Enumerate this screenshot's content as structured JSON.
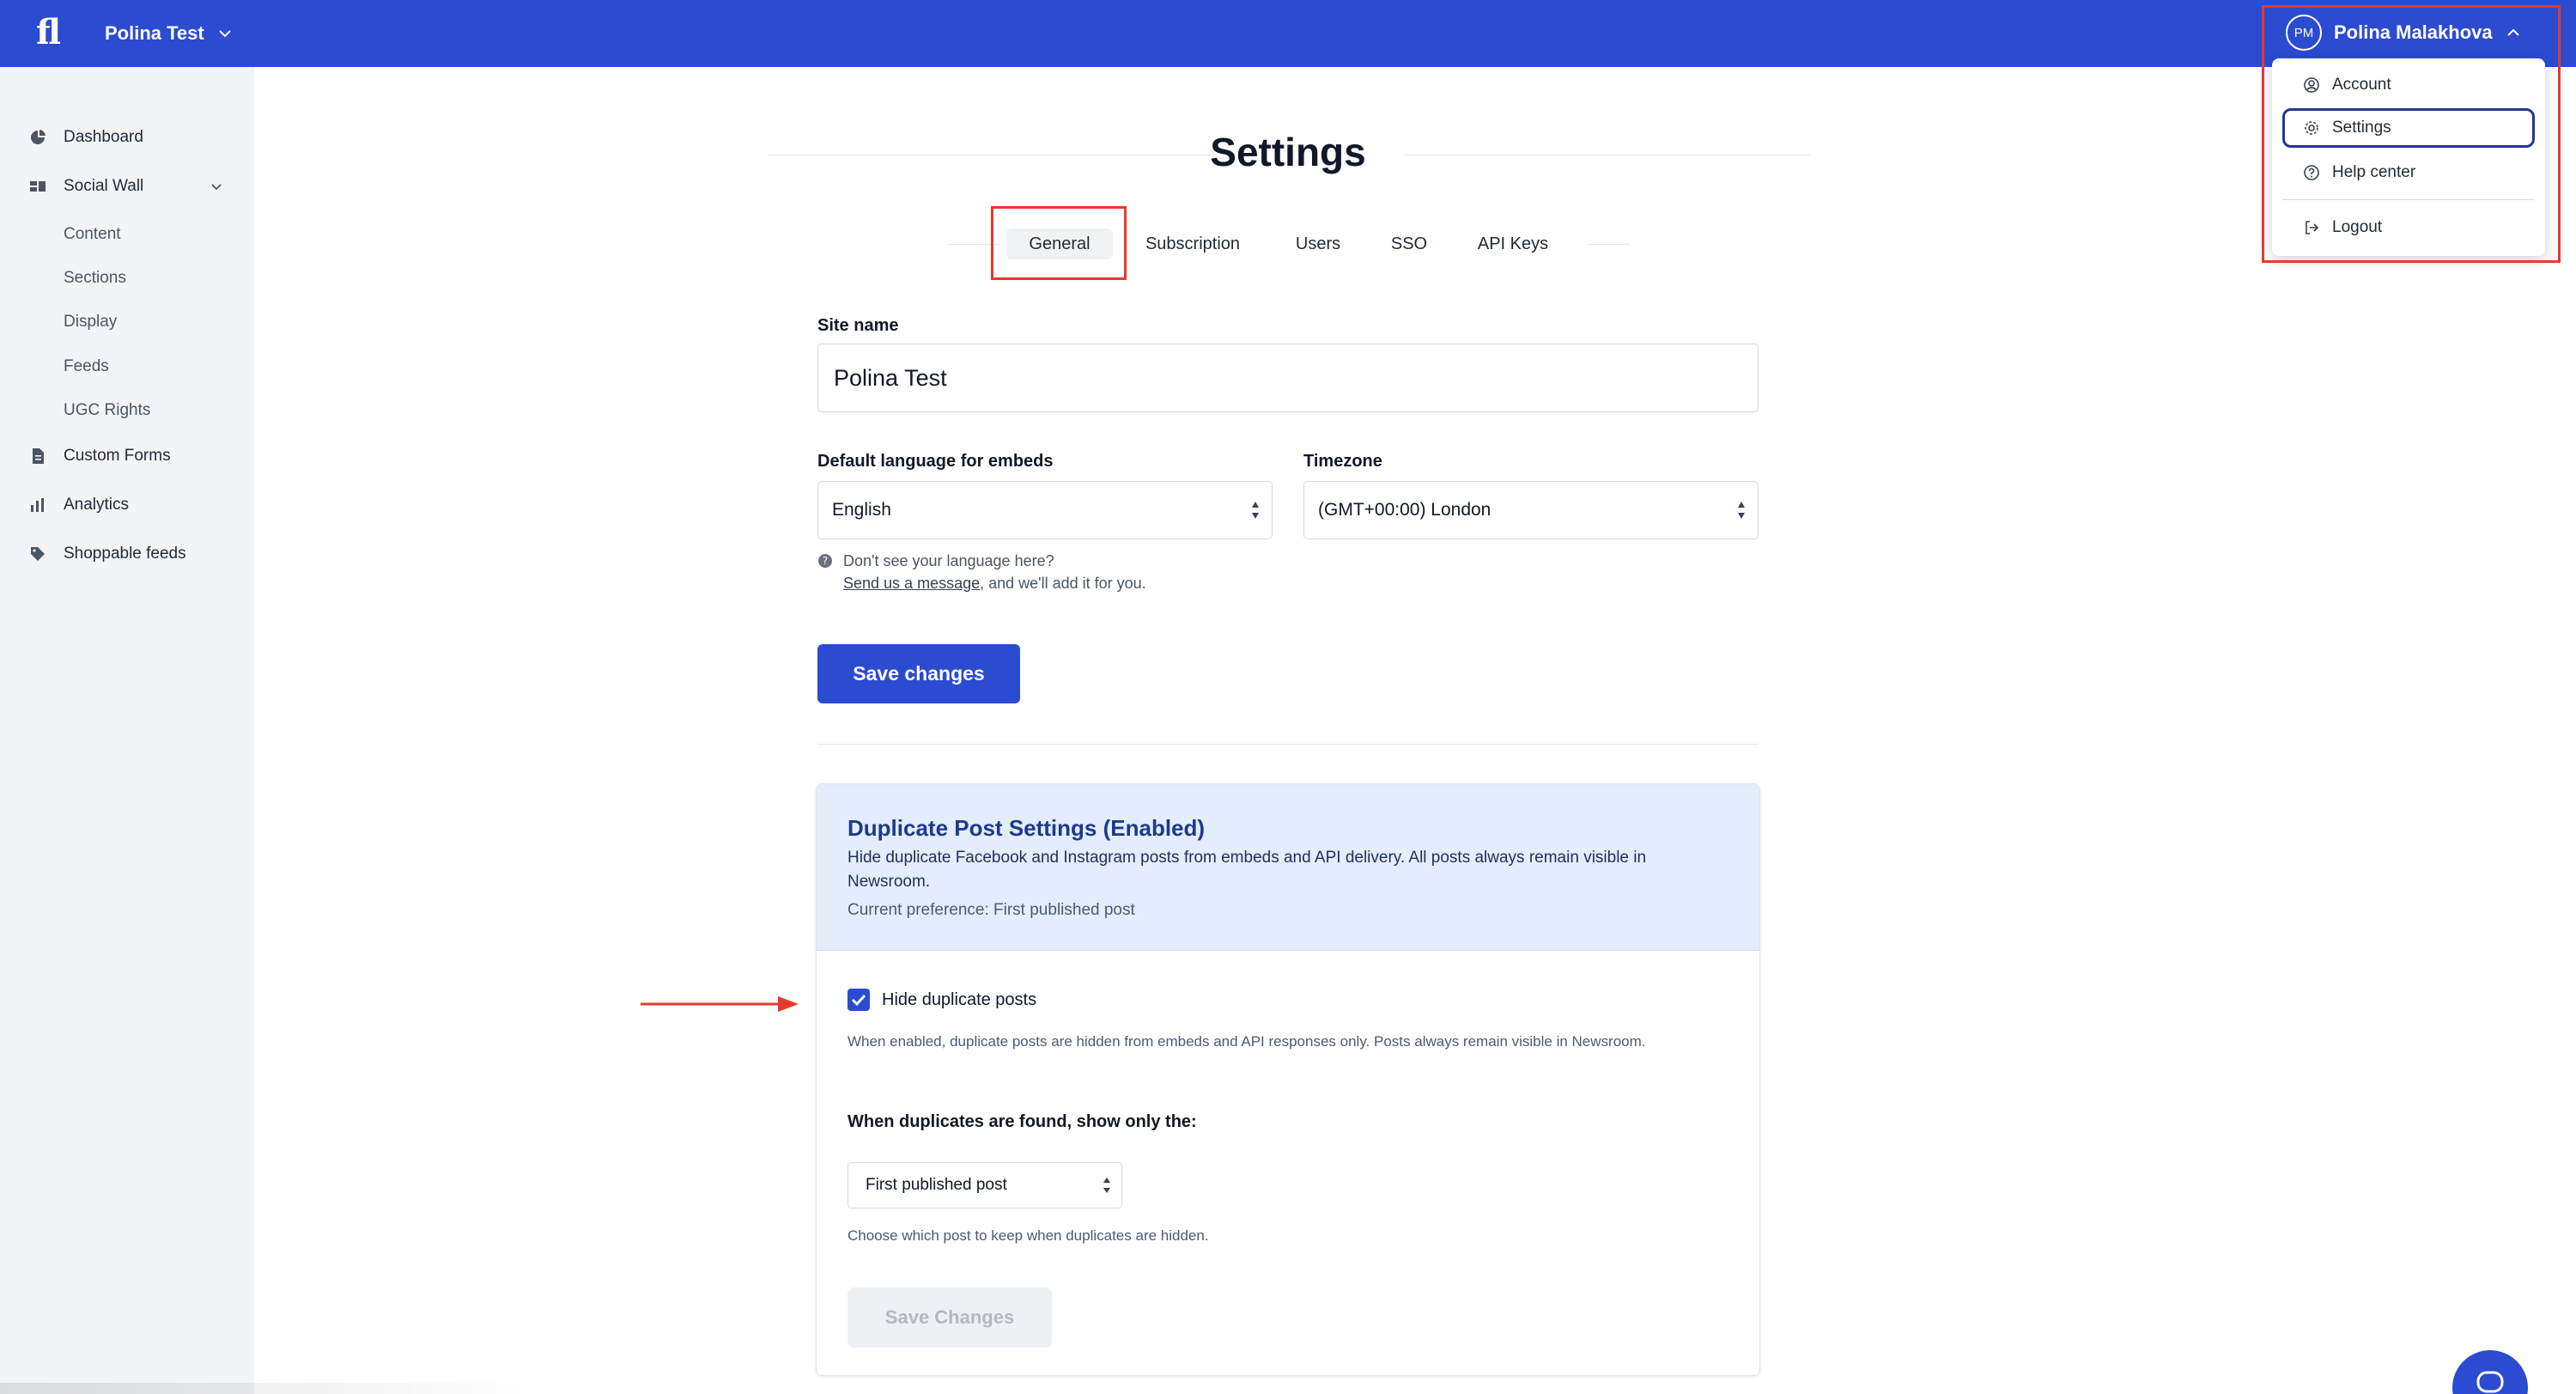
{
  "topbar": {
    "logo": "fl",
    "site_name": "Polina Test",
    "user_initials": "PM",
    "user_name": "Polina Malakhova"
  },
  "user_menu": {
    "items": [
      {
        "label": "Account",
        "icon": "account-icon"
      },
      {
        "label": "Settings",
        "icon": "gear-icon",
        "active": true
      },
      {
        "label": "Help center",
        "icon": "help-icon"
      },
      {
        "label": "Logout",
        "icon": "logout-icon"
      }
    ]
  },
  "sidebar": {
    "items": [
      {
        "label": "Dashboard",
        "icon": "dashboard-icon"
      },
      {
        "label": "Social Wall",
        "icon": "social-wall-icon",
        "expanded": true
      },
      {
        "label": "Custom Forms",
        "icon": "form-icon"
      },
      {
        "label": "Analytics",
        "icon": "bar-chart-icon"
      },
      {
        "label": "Shoppable feeds",
        "icon": "tag-icon"
      }
    ],
    "sub_items": [
      "Content",
      "Sections",
      "Display",
      "Feeds",
      "UGC Rights"
    ]
  },
  "page": {
    "title": "Settings",
    "tabs": [
      "General",
      "Subscription",
      "Users",
      "SSO",
      "API Keys"
    ],
    "active_tab": "General"
  },
  "general": {
    "site_name_label": "Site name",
    "site_name_value": "Polina Test",
    "language_label": "Default language for embeds",
    "language_value": "English",
    "timezone_label": "Timezone",
    "timezone_value": "(GMT+00:00) London",
    "hint_line1": "Don't see your language here?",
    "hint_link": "Send us a message",
    "hint_rest": ", and we'll add it for you.",
    "save_label": "Save changes"
  },
  "duplicate": {
    "title": "Duplicate Post Settings (Enabled)",
    "description": "Hide duplicate Facebook and Instagram posts from embeds and API delivery. All posts always remain visible in Newsroom.",
    "current_preference": "Current preference: First published post",
    "checkbox_label": "Hide duplicate posts",
    "checkbox_checked": true,
    "checkbox_help": "When enabled, duplicate posts are hidden from embeds and API responses only. Posts always remain visible in Newsroom.",
    "show_label": "When duplicates are found, show only the:",
    "select_value": "First published post",
    "select_help": "Choose which post to keep when duplicates are hidden.",
    "save_label": "Save Changes"
  },
  "colors": {
    "brand": "#2b4bd1",
    "annotation_red": "#e43a2f",
    "card_header_bg": "#e3edfb"
  }
}
